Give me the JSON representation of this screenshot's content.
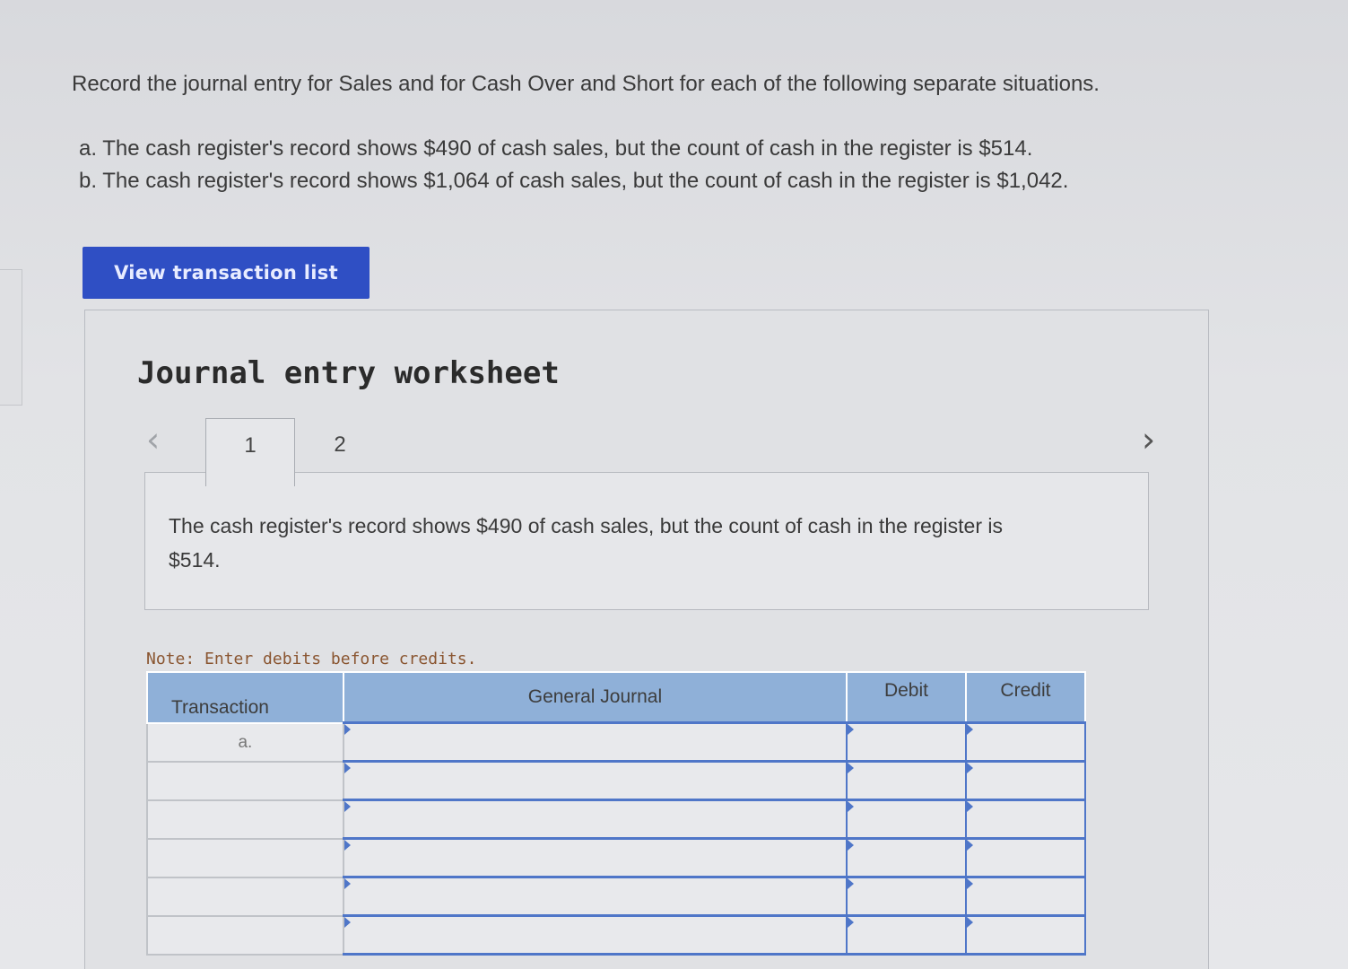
{
  "instruction": "Record the journal entry for Sales and for Cash Over and Short for each of the following separate situations.",
  "situations": [
    "a. The cash register's record shows $490 of cash sales, but the count of cash in the register is $514.",
    "b. The cash register's record shows $1,064 of cash sales, but the count of cash in the register is $1,042."
  ],
  "view_button_label": "View transaction list",
  "worksheet": {
    "title": "Journal entry worksheet",
    "nav_prev_icon": "chevron-left-icon",
    "nav_next_icon": "chevron-right-icon",
    "tabs": [
      {
        "label": "1",
        "active": true
      },
      {
        "label": "2",
        "active": false
      }
    ],
    "description": "The cash register's record shows $490 of cash sales, but the count of cash in the register is $514.",
    "note": "Note: Enter debits before credits.",
    "table": {
      "headers": {
        "transaction": "Transaction",
        "general_journal": "General Journal",
        "debit": "Debit",
        "credit": "Credit"
      },
      "rows": [
        {
          "transaction": "a.",
          "account": "",
          "debit": "",
          "credit": ""
        },
        {
          "transaction": "",
          "account": "",
          "debit": "",
          "credit": ""
        },
        {
          "transaction": "",
          "account": "",
          "debit": "",
          "credit": ""
        },
        {
          "transaction": "",
          "account": "",
          "debit": "",
          "credit": ""
        },
        {
          "transaction": "",
          "account": "",
          "debit": "",
          "credit": ""
        },
        {
          "transaction": "",
          "account": "",
          "debit": "",
          "credit": ""
        }
      ]
    }
  },
  "colors": {
    "button_bg": "#2f4fc4",
    "header_bg": "#8fb0d8",
    "input_border": "#4f76c8",
    "note_text": "#8a5530"
  }
}
